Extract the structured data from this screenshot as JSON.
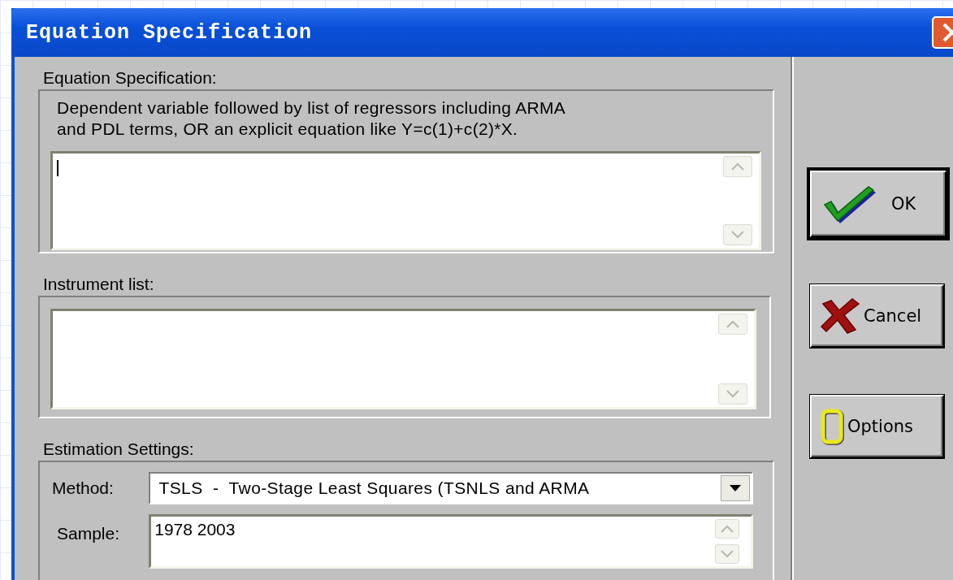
{
  "window": {
    "title": "Equation Specification"
  },
  "equation_specification": {
    "label": "Equation Specification:",
    "help_lines": [
      "Dependent variable followed by list of regressors including ARMA",
      "and PDL terms, OR an explicit equation like Y=c(1)+c(2)*X."
    ]
  },
  "instrument_list": {
    "label": "Instrument list:"
  },
  "estimation_settings": {
    "label": "Estimation Settings:",
    "method": {
      "label": "Method:",
      "value": "TSLS  -  Two-Stage Least Squares (TSNLS and ARMA"
    },
    "sample": {
      "label": "Sample:",
      "value": "1978 2003"
    }
  },
  "buttons": [
    {
      "label": "OK",
      "kind": "ok",
      "default": true
    },
    {
      "label": "Cancel",
      "kind": "cancel",
      "default": false
    },
    {
      "label": "Options",
      "kind": "options",
      "default": false
    }
  ]
}
